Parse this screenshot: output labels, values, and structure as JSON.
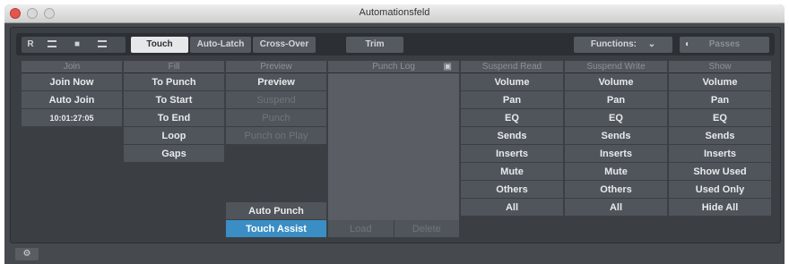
{
  "window": {
    "title": "Automationsfeld"
  },
  "toolbar": {
    "r_label": "R",
    "touch_label": "Touch",
    "autolatch_label": "Auto-Latch",
    "crossover_label": "Cross-Over",
    "trim_label": "Trim",
    "functions_label": "Functions:",
    "passes_label": "Passes"
  },
  "columns": {
    "join": {
      "header": "Join",
      "items": [
        "Join Now",
        "Auto Join",
        "10:01:27:05"
      ]
    },
    "fill": {
      "header": "Fill",
      "items": [
        "To Punch",
        "To Start",
        "To End",
        "Loop",
        "Gaps"
      ]
    },
    "preview": {
      "header": "Preview",
      "items": [
        "Preview",
        "Suspend",
        "Punch",
        "Punch on Play"
      ],
      "bottom": [
        "Auto Punch",
        "Touch Assist"
      ]
    },
    "punchlog": {
      "header": "Punch Log",
      "buttons": [
        "Load",
        "Delete"
      ]
    },
    "suspend_read": {
      "header": "Suspend Read",
      "items": [
        "Volume",
        "Pan",
        "EQ",
        "Sends",
        "Inserts",
        "Mute",
        "Others",
        "All"
      ]
    },
    "suspend_write": {
      "header": "Suspend Write",
      "items": [
        "Volume",
        "Pan",
        "EQ",
        "Sends",
        "Inserts",
        "Mute",
        "Others",
        "All"
      ]
    },
    "show": {
      "header": "Show",
      "items": [
        "Volume",
        "Pan",
        "EQ",
        "Sends",
        "Inserts",
        "Show Used",
        "Used Only",
        "Hide All"
      ]
    }
  },
  "colors": {
    "accent": "#3b8ec4",
    "panel": "#50555b",
    "window": "#464a4f"
  }
}
